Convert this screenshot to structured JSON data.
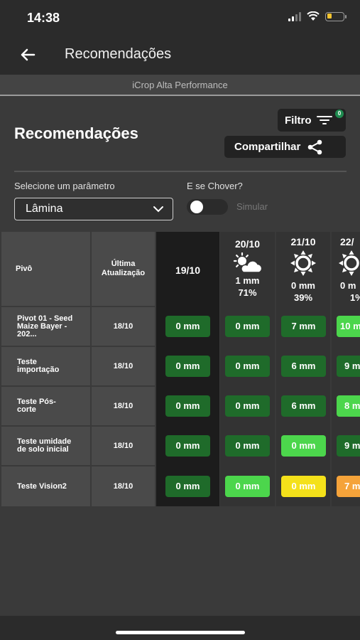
{
  "status_bar": {
    "time": "14:38",
    "icons": [
      "signal-icon",
      "wifi-icon",
      "battery-icon"
    ],
    "battery_color": "#f4c430"
  },
  "app_bar": {
    "title": "Recomendações",
    "back_icon": "arrow-left-icon"
  },
  "sub_header": {
    "text": "iCrop Alta Performance"
  },
  "page": {
    "title": "Recomendações"
  },
  "buttons": {
    "filter_label": "Filtro",
    "filter_badge": "0",
    "share_label": "Compartilhar"
  },
  "params": {
    "label": "Selecione um parâmetro",
    "selected": "Lâmina"
  },
  "rain": {
    "label": "E se Chover?",
    "toggle_label": "Simular",
    "enabled": false
  },
  "table": {
    "headers": {
      "pivot": "Pivô",
      "last_update": "Última Atualização"
    },
    "days": [
      {
        "date": "19/10",
        "icon": "",
        "rain": "",
        "prob": ""
      },
      {
        "date": "20/10",
        "icon": "partly-cloudy-icon",
        "rain": "1 mm",
        "prob": "71%"
      },
      {
        "date": "21/10",
        "icon": "sun-icon",
        "rain": "0 mm",
        "prob": "39%"
      },
      {
        "date": "22/",
        "icon": "sun-icon",
        "rain": "0 m",
        "prob": "1%"
      }
    ],
    "rows": [
      {
        "pivot": "Pivot 01 - Seed Maize Bayer - 202...",
        "updated": "18/10",
        "values": [
          "0 mm",
          "0 mm",
          "7 mm",
          "10 m"
        ],
        "levels": [
          "dark",
          "dark",
          "dark",
          "light"
        ]
      },
      {
        "pivot": "Teste importação",
        "updated": "18/10",
        "values": [
          "0 mm",
          "0 mm",
          "6 mm",
          "9 m"
        ],
        "levels": [
          "dark",
          "dark",
          "dark",
          "dark"
        ]
      },
      {
        "pivot": "Teste Pós-corte",
        "updated": "18/10",
        "values": [
          "0 mm",
          "0 mm",
          "6 mm",
          "8 m"
        ],
        "levels": [
          "dark",
          "dark",
          "dark",
          "light"
        ]
      },
      {
        "pivot": "Teste umidade de solo inicial",
        "updated": "18/10",
        "values": [
          "0 mm",
          "0 mm",
          "0 mm",
          "9 m"
        ],
        "levels": [
          "dark",
          "dark",
          "light",
          "dark"
        ]
      },
      {
        "pivot": "Teste Vision2",
        "updated": "18/10",
        "values": [
          "0 mm",
          "0 mm",
          "0 mm",
          "7 m"
        ],
        "levels": [
          "dark",
          "light",
          "yellow",
          "orange"
        ]
      }
    ]
  },
  "colors": {
    "dark_green": "#1f6b2a",
    "light_green": "#4cd64c",
    "yellow": "#f4e11a",
    "orange": "#f5a33a",
    "badge_green": "#1e8b4f"
  }
}
